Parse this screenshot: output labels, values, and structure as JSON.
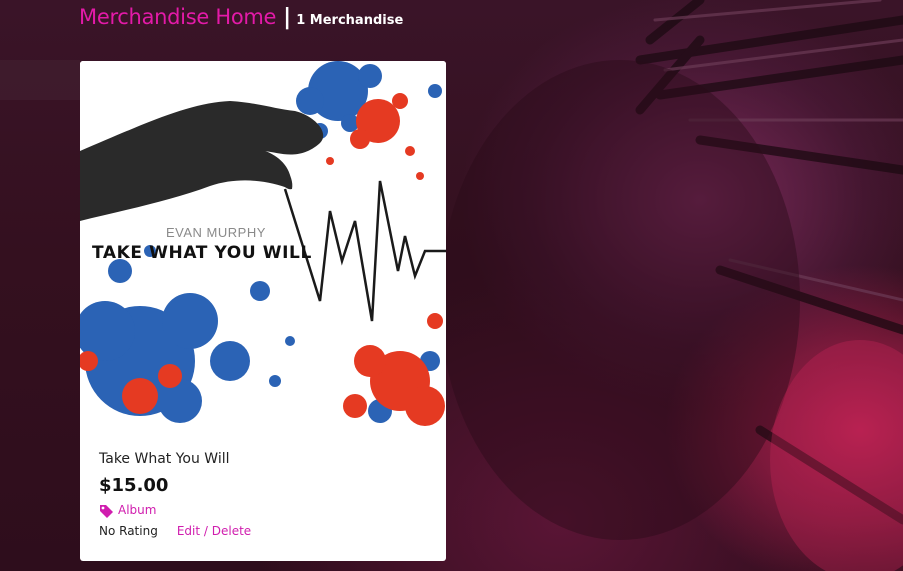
{
  "header": {
    "title": "Merchandise Home",
    "separator": "|",
    "count": "1 Merchandise"
  },
  "colors": {
    "accent": "#e31aa8",
    "link": "#d01dae",
    "background": "#3a1226",
    "card": "#ffffff"
  },
  "product": {
    "cover_artist": "EVAN MURPHY",
    "cover_title": "TAKE WHAT YOU WILL",
    "name": "Take What You Will",
    "price": "$15.00",
    "category_icon": "tag-icon",
    "category": "Album",
    "rating": "No Rating",
    "actions": "Edit / Delete"
  }
}
